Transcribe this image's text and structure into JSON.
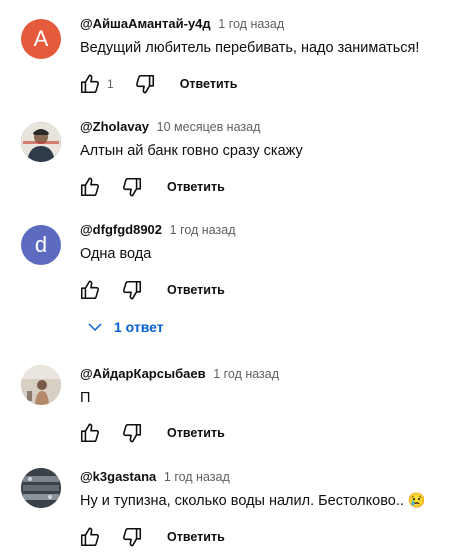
{
  "comments": [
    {
      "author": "@АйшаАмантай-у4д",
      "time": "1 год назад",
      "text": "Ведущий любитель перебивать, надо заниматься!",
      "avatar_letter": "A",
      "avatar_color": "#e65a3c",
      "likes": "1",
      "reply_label": "Ответить"
    },
    {
      "author": "@Zholavay",
      "time": "10 месяцев назад",
      "text": "Алтын ай банк говно сразу скажу",
      "avatar_letter": "",
      "avatar_color": "#3a3540",
      "reply_label": "Ответить"
    },
    {
      "author": "@dfgfgd8902",
      "time": "1 год назад",
      "text": "Одна вода",
      "avatar_letter": "d",
      "avatar_color": "#5c6bc0",
      "reply_label": "Ответить",
      "replies_label": "1 ответ"
    },
    {
      "author": "@АйдарКарсыбаев",
      "time": "1 год назад",
      "text": "П",
      "avatar_letter": "",
      "avatar_color": "#c9b8a8",
      "reply_label": "Ответить"
    },
    {
      "author": "@k3gastana",
      "time": "1 год назад",
      "text": "Ну и тупизна, сколько воды налил. Бестолково..",
      "emoji": "😢",
      "avatar_letter": "",
      "avatar_color": "#4a5058",
      "reply_label": "Ответить"
    }
  ],
  "icons": {
    "like": "thumb-up-icon",
    "dislike": "thumb-down-icon",
    "expand": "chevron-down-icon"
  },
  "colors": {
    "link": "#065fd4",
    "secondary_text": "#606060"
  }
}
